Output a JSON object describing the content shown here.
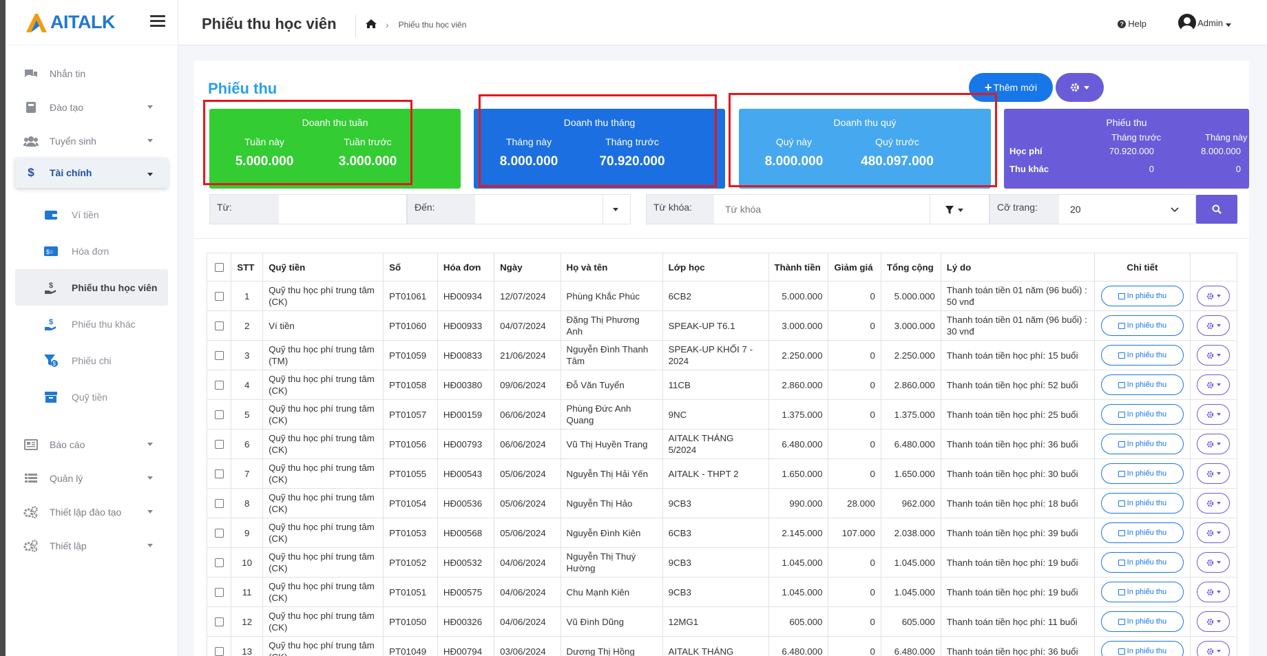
{
  "brand": {
    "name": "AITALK"
  },
  "sidebar": {
    "items": [
      {
        "label": "Nhắn tin"
      },
      {
        "label": "Đào tạo"
      },
      {
        "label": "Tuyển sinh"
      },
      {
        "label": "Tài chính"
      }
    ],
    "sub_items": [
      {
        "label": "Ví tiền"
      },
      {
        "label": "Hóa đơn"
      },
      {
        "label": "Phiếu thu học viên"
      },
      {
        "label": "Phiếu thu khác"
      },
      {
        "label": "Phiếu chi"
      },
      {
        "label": "Quỹ tiền"
      }
    ],
    "bottom_items": [
      {
        "label": "Báo cáo"
      },
      {
        "label": "Quản lý"
      },
      {
        "label": "Thiết lập đào tạo"
      },
      {
        "label": "Thiết lập"
      }
    ]
  },
  "header": {
    "title": "Phiếu thu học viên",
    "breadcrumb": "Phiếu thu học viên",
    "help": "Help",
    "user": "Admin"
  },
  "card": {
    "title": "Phiếu thu",
    "add_button": "Thêm mới"
  },
  "stats": {
    "week": {
      "title": "Doanh thu tuần",
      "this_label": "Tuần này",
      "prev_label": "Tuần trước",
      "this_value": "5.000.000",
      "prev_value": "3.000.000"
    },
    "month": {
      "title": "Doanh thu tháng",
      "this_label": "Tháng này",
      "prev_label": "Tháng trước",
      "this_value": "8.000.000",
      "prev_value": "70.920.000"
    },
    "quarter": {
      "title": "Doanh thu quý",
      "this_label": "Quý này",
      "prev_label": "Quý trước",
      "this_value": "8.000.000",
      "prev_value": "480.097.000"
    },
    "receipts": {
      "title": "Phiếu thu",
      "col_prev": "Tháng trước",
      "col_this": "Tháng này",
      "row1_label": "Học phí",
      "row1_prev": "70.920.000",
      "row1_this": "8.000.000",
      "row2_label": "Thu khác",
      "row2_prev": "0",
      "row2_this": "0"
    }
  },
  "filters": {
    "from_label": "Từ:",
    "to_label": "Đến:",
    "keyword_label": "Từ khóa:",
    "keyword_placeholder": "Từ khóa",
    "page_size_label": "Cỡ trang:",
    "page_size_value": "20"
  },
  "table": {
    "headers": {
      "stt": "STT",
      "fund": "Quỹ tiền",
      "no": "Số",
      "invoice": "Hóa đơn",
      "date": "Ngày",
      "name": "Họ và tên",
      "class": "Lớp học",
      "amount": "Thành tiền",
      "discount": "Giảm giá",
      "total": "Tổng cộng",
      "reason": "Lý do",
      "detail": "Chi tiết"
    },
    "print_label": "In phiếu thu",
    "rows": [
      {
        "stt": "1",
        "fund": "Quỹ thu học phí trung tâm (CK)",
        "no": "PT01061",
        "invoice": "HĐ00934",
        "date": "12/07/2024",
        "name": "Phùng Khắc Phúc",
        "class": "6CB2",
        "amount": "5.000.000",
        "discount": "0",
        "total": "5.000.000",
        "reason": "Thanh toán tiền 01 năm (96 buổi) : 50 vnđ"
      },
      {
        "stt": "2",
        "fund": "Ví tiền",
        "no": "PT01060",
        "invoice": "HĐ00933",
        "date": "04/07/2024",
        "name": "Đặng Thị Phương Anh",
        "class": "SPEAK-UP T6.1",
        "amount": "3.000.000",
        "discount": "0",
        "total": "3.000.000",
        "reason": "Thanh toán tiền 01 năm (96 buổi) : 30 vnđ"
      },
      {
        "stt": "3",
        "fund": "Quỹ thu học phí trung tâm (TM)",
        "no": "PT01059",
        "invoice": "HĐ00833",
        "date": "21/06/2024",
        "name": "Nguyễn Đình Thanh Tâm",
        "class": "SPEAK-UP KHỐI 7 - 2024",
        "amount": "2.250.000",
        "discount": "0",
        "total": "2.250.000",
        "reason": "Thanh toán tiền học phí: 15 buổi"
      },
      {
        "stt": "4",
        "fund": "Quỹ thu học phí trung tâm (CK)",
        "no": "PT01058",
        "invoice": "HĐ00380",
        "date": "09/06/2024",
        "name": "Đỗ Văn Tuyển",
        "class": "11CB",
        "amount": "2.860.000",
        "discount": "0",
        "total": "2.860.000",
        "reason": "Thanh toán tiền học phí: 52 buổi"
      },
      {
        "stt": "5",
        "fund": "Quỹ thu học phí trung tâm (CK)",
        "no": "PT01057",
        "invoice": "HĐ00159",
        "date": "06/06/2024",
        "name": "Phùng Đức Anh Quang",
        "class": "9NC",
        "amount": "1.375.000",
        "discount": "0",
        "total": "1.375.000",
        "reason": "Thanh toán tiền học phí: 25 buổi"
      },
      {
        "stt": "6",
        "fund": "Quỹ thu học phí trung tâm (CK)",
        "no": "PT01056",
        "invoice": "HĐ00793",
        "date": "06/06/2024",
        "name": "Vũ Thị Huyền Trang",
        "class": "AITALK THÁNG 5/2024",
        "amount": "6.480.000",
        "discount": "0",
        "total": "6.480.000",
        "reason": "Thanh toán tiền học phí: 36 buổi"
      },
      {
        "stt": "7",
        "fund": "Quỹ thu học phí trung tâm (CK)",
        "no": "PT01055",
        "invoice": "HĐ00543",
        "date": "05/06/2024",
        "name": "Nguyễn Thị Hải Yến",
        "class": "AITALK - THPT 2",
        "amount": "1.650.000",
        "discount": "0",
        "total": "1.650.000",
        "reason": "Thanh toán tiền học phí: 30 buổi"
      },
      {
        "stt": "8",
        "fund": "Quỹ thu học phí trung tâm (CK)",
        "no": "PT01054",
        "invoice": "HĐ00536",
        "date": "05/06/2024",
        "name": "Nguyễn Thị Hảo",
        "class": "9CB3",
        "amount": "990.000",
        "discount": "28.000",
        "total": "962.000",
        "reason": "Thanh toán tiền học phí: 18 buổi"
      },
      {
        "stt": "9",
        "fund": "Quỹ thu học phí trung tâm (CK)",
        "no": "PT01053",
        "invoice": "HĐ00568",
        "date": "05/06/2024",
        "name": "Nguyễn Đình Kiên",
        "class": "6CB3",
        "amount": "2.145.000",
        "discount": "107.000",
        "total": "2.038.000",
        "reason": "Thanh toán tiền học phí: 39 buổi"
      },
      {
        "stt": "10",
        "fund": "Quỹ thu học phí trung tâm (CK)",
        "no": "PT01052",
        "invoice": "HĐ00532",
        "date": "04/06/2024",
        "name": "Nguyễn Thị Thuý Hường",
        "class": "9CB3",
        "amount": "1.045.000",
        "discount": "0",
        "total": "1.045.000",
        "reason": "Thanh toán tiền học phí: 19 buổi"
      },
      {
        "stt": "11",
        "fund": "Quỹ thu học phí trung tâm (CK)",
        "no": "PT01051",
        "invoice": "HĐ00575",
        "date": "04/06/2024",
        "name": "Chu Mạnh Kiên",
        "class": "9CB3",
        "amount": "1.045.000",
        "discount": "0",
        "total": "1.045.000",
        "reason": "Thanh toán tiền học phí: 19 buổi"
      },
      {
        "stt": "12",
        "fund": "Quỹ thu học phí trung tâm (CK)",
        "no": "PT01050",
        "invoice": "HĐ00326",
        "date": "04/06/2024",
        "name": "Vũ Đình Dũng",
        "class": "12MG1",
        "amount": "605.000",
        "discount": "0",
        "total": "605.000",
        "reason": "Thanh toán tiền học phí: 11 buổi"
      },
      {
        "stt": "13",
        "fund": "Quỹ thu học phí trung tâm (CK)",
        "no": "PT01049",
        "invoice": "HĐ00794",
        "date": "03/06/2024",
        "name": "Dương Thị Hồng",
        "class": "AITALK THÁNG",
        "amount": "6.480.000",
        "discount": "0",
        "total": "6.480.000",
        "reason": "Thanh toán tiền học phí: 36 buổi"
      }
    ]
  },
  "colors": {
    "accent_blue": "#1776e8",
    "purple": "#6a5bd8",
    "green": "#33cc33",
    "title_blue": "#2aa0e8",
    "highlight_red": "#e8161b"
  }
}
